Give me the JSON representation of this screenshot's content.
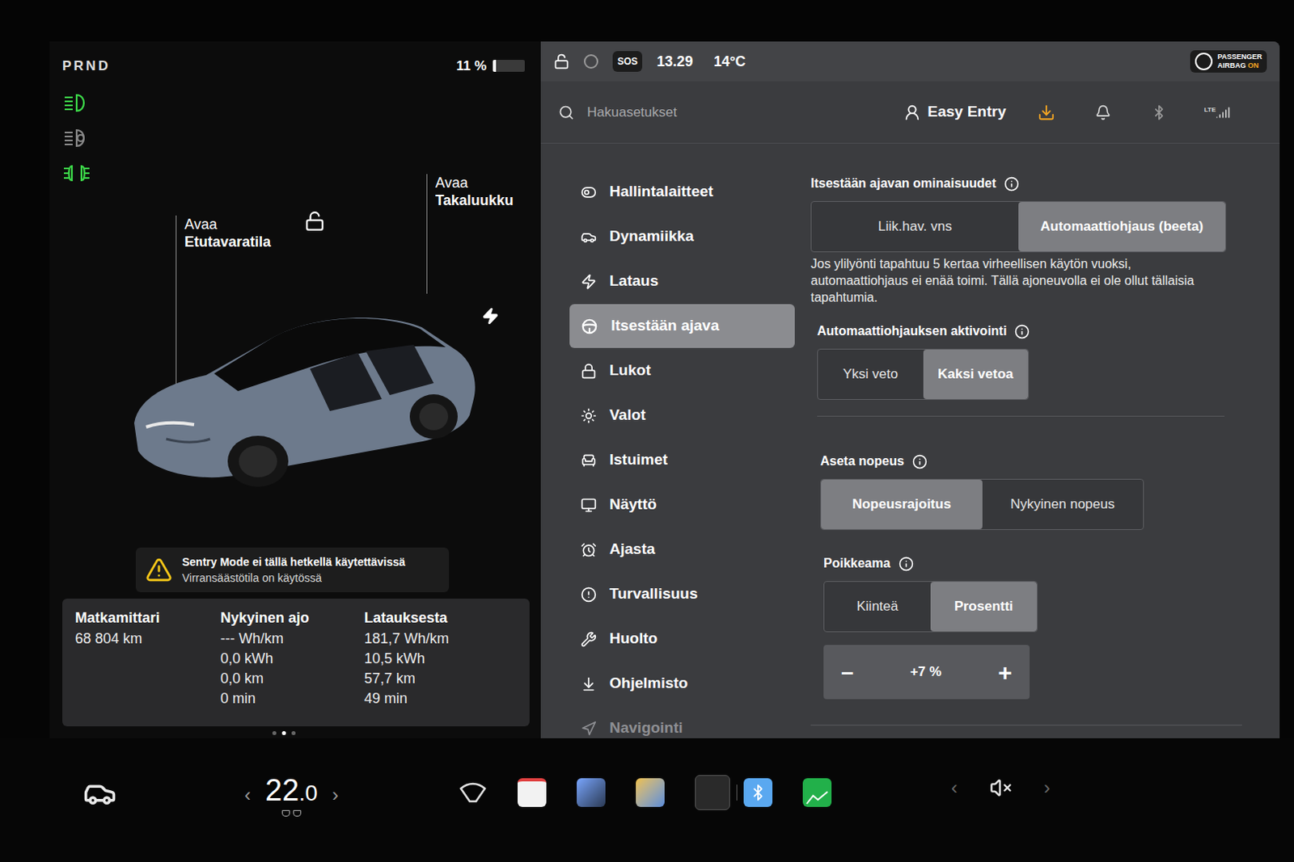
{
  "drive": {
    "gears": "PRND",
    "battery": "11 %",
    "battery_level": 0.11
  },
  "indicators": [
    {
      "kind": "low-beam",
      "on": true
    },
    {
      "kind": "auto-high-beam",
      "on": false
    },
    {
      "kind": "parking-lights",
      "on": true
    }
  ],
  "car": {
    "locked": false,
    "charging": true,
    "frunk": {
      "action": "Avaa",
      "label": "Etutavaratila"
    },
    "trunk": {
      "action": "Avaa",
      "label": "Takaluukku"
    }
  },
  "alert": {
    "title": "Sentry Mode ei tällä hetkellä käytettävissä",
    "subtitle": "Virransäästötila on käytössä"
  },
  "trip_stats": [
    {
      "title": "Matkamittari",
      "values": [
        "68 804 km"
      ]
    },
    {
      "title": "Nykyinen ajo",
      "values": [
        "--- Wh/km",
        "0,0 kWh",
        "0,0 km",
        "0 min"
      ]
    },
    {
      "title": "Latauksesta",
      "values": [
        "181,7 Wh/km",
        "10,5 kWh",
        "57,7 km",
        "49 min"
      ]
    }
  ],
  "page_dots": [
    {
      "selected": false
    },
    {
      "selected": true
    },
    {
      "selected": false
    }
  ],
  "status_bar": {
    "locked": false,
    "sos": "SOS",
    "time": "13.29",
    "temperature": "14°C",
    "airbag": {
      "line1": "PASSENGER",
      "line2": "AIRBAG",
      "state": "ON"
    }
  },
  "search": {
    "placeholder": "Hakuasetukset"
  },
  "profile": {
    "name": "Easy Entry"
  },
  "header_icons": {
    "update_available": true,
    "lte": "LTE"
  },
  "sidebar": {
    "items": [
      {
        "label": "Hallintalaitteet",
        "selected": false,
        "faded": false
      },
      {
        "label": "Dynamiikka",
        "selected": false,
        "faded": false
      },
      {
        "label": "Lataus",
        "selected": false,
        "faded": false
      },
      {
        "label": "Itsestään ajava",
        "selected": true,
        "faded": false
      },
      {
        "label": "Lukot",
        "selected": false,
        "faded": false
      },
      {
        "label": "Valot",
        "selected": false,
        "faded": false
      },
      {
        "label": "Istuimet",
        "selected": false,
        "faded": false
      },
      {
        "label": "Näyttö",
        "selected": false,
        "faded": false
      },
      {
        "label": "Ajasta",
        "selected": false,
        "faded": false
      },
      {
        "label": "Turvallisuus",
        "selected": false,
        "faded": false
      },
      {
        "label": "Huolto",
        "selected": false,
        "faded": false
      },
      {
        "label": "Ohjelmisto",
        "selected": false,
        "faded": false
      },
      {
        "label": "Navigointi",
        "selected": false,
        "faded": true
      }
    ]
  },
  "settings": {
    "sections": [
      {
        "title": "Itsestään ajavan ominaisuudet",
        "info": true,
        "options": [
          {
            "label": "Liik.hav. vns",
            "selected": false
          },
          {
            "label": "Automaattiohjaus (beeta)",
            "selected": true
          }
        ],
        "note": "Jos ylilyönti tapahtuu 5 kertaa virheellisen käytön vuoksi, automaattiohjaus ei enää toimi. Tällä ajoneuvolla ei ole ollut tällaisia tapahtumia."
      },
      {
        "title": "Automaattiohjauksen aktivointi",
        "info": true,
        "options": [
          {
            "label": "Yksi veto",
            "selected": false
          },
          {
            "label": "Kaksi vetoa",
            "selected": true
          }
        ],
        "note": ""
      },
      {
        "title": "Aseta nopeus",
        "info": true,
        "options": [
          {
            "label": "Nopeusrajoitus",
            "selected": true
          },
          {
            "label": "Nykyinen nopeus",
            "selected": false
          }
        ],
        "note": ""
      },
      {
        "title": "Poikkeama",
        "info": true,
        "options": [
          {
            "label": "Kiinteä",
            "selected": false
          },
          {
            "label": "Prosentti",
            "selected": true
          }
        ],
        "note": ""
      }
    ],
    "offset_stepper": {
      "minus": "–",
      "value": "+7 %",
      "plus": "+"
    }
  },
  "bottom_bar": {
    "temp_whole": "22",
    "temp_decimal": ".0",
    "prev": "‹",
    "next": "›",
    "volume_prev": "‹",
    "volume_next": "›",
    "muted": true
  }
}
